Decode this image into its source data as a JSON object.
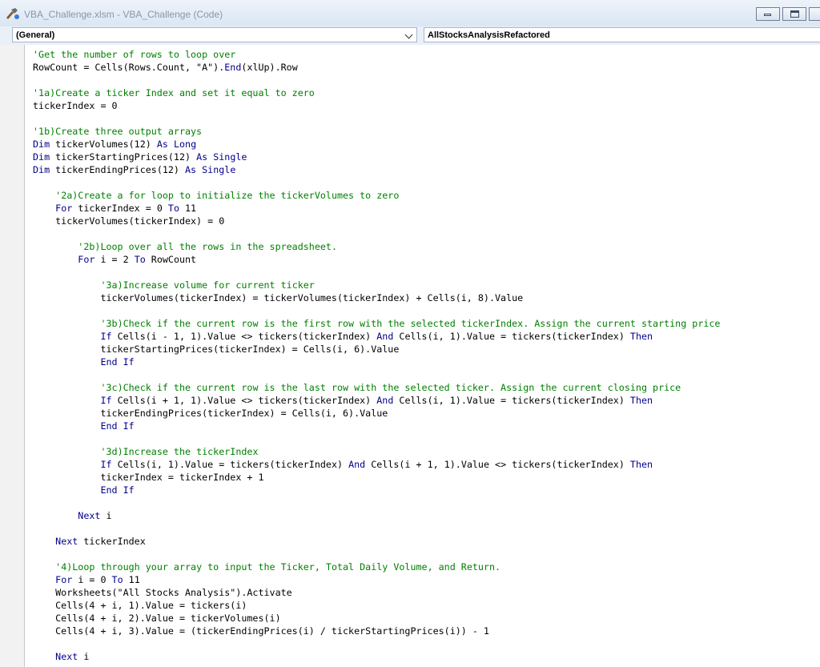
{
  "window": {
    "title": "VBA_Challenge.xlsm - VBA_Challenge (Code)",
    "buttons": [
      "minimize",
      "maximize",
      "close"
    ]
  },
  "selectors": {
    "object": "(General)",
    "procedure": "AllStocksAnalysisRefactored"
  },
  "colors": {
    "comment": "#008000",
    "keyword": "#00008b",
    "text": "#000000"
  },
  "code_lines": [
    {
      "indent": 0,
      "text": "'Get the number of rows to loop over",
      "type": "comment"
    },
    {
      "indent": 0,
      "text": "RowCount = Cells(Rows.Count, \"A\").End(xlUp).Row",
      "type": "code"
    },
    {
      "indent": 0,
      "text": "",
      "type": "blank"
    },
    {
      "indent": 0,
      "text": "'1a)Create a ticker Index and set it equal to zero",
      "type": "comment"
    },
    {
      "indent": 0,
      "text": "tickerIndex = 0",
      "type": "code"
    },
    {
      "indent": 0,
      "text": "",
      "type": "blank"
    },
    {
      "indent": 0,
      "text": "'1b)Create three output arrays",
      "type": "comment"
    },
    {
      "indent": 0,
      "text": "Dim tickerVolumes(12) As Long",
      "type": "code"
    },
    {
      "indent": 0,
      "text": "Dim tickerStartingPrices(12) As Single",
      "type": "code"
    },
    {
      "indent": 0,
      "text": "Dim tickerEndingPrices(12) As Single",
      "type": "code"
    },
    {
      "indent": 0,
      "text": "",
      "type": "blank"
    },
    {
      "indent": 1,
      "text": "'2a)Create a for loop to initialize the tickerVolumes to zero",
      "type": "comment"
    },
    {
      "indent": 1,
      "text": "For tickerIndex = 0 To 11",
      "type": "code"
    },
    {
      "indent": 1,
      "text": "tickerVolumes(tickerIndex) = 0",
      "type": "code"
    },
    {
      "indent": 0,
      "text": "",
      "type": "blank"
    },
    {
      "indent": 2,
      "text": "'2b)Loop over all the rows in the spreadsheet.",
      "type": "comment"
    },
    {
      "indent": 2,
      "text": "For i = 2 To RowCount",
      "type": "code"
    },
    {
      "indent": 0,
      "text": "",
      "type": "blank"
    },
    {
      "indent": 3,
      "text": "'3a)Increase volume for current ticker",
      "type": "comment"
    },
    {
      "indent": 3,
      "text": "tickerVolumes(tickerIndex) = tickerVolumes(tickerIndex) + Cells(i, 8).Value",
      "type": "code"
    },
    {
      "indent": 0,
      "text": "",
      "type": "blank"
    },
    {
      "indent": 3,
      "text": "'3b)Check if the current row is the first row with the selected tickerIndex. Assign the current starting price",
      "type": "comment"
    },
    {
      "indent": 3,
      "text": "If Cells(i - 1, 1).Value <> tickers(tickerIndex) And Cells(i, 1).Value = tickers(tickerIndex) Then",
      "type": "code"
    },
    {
      "indent": 3,
      "text": "tickerStartingPrices(tickerIndex) = Cells(i, 6).Value",
      "type": "code"
    },
    {
      "indent": 3,
      "text": "End If",
      "type": "code"
    },
    {
      "indent": 0,
      "text": "",
      "type": "blank"
    },
    {
      "indent": 3,
      "text": "'3c)Check if the current row is the last row with the selected ticker. Assign the current closing price",
      "type": "comment"
    },
    {
      "indent": 3,
      "text": "If Cells(i + 1, 1).Value <> tickers(tickerIndex) And Cells(i, 1).Value = tickers(tickerIndex) Then",
      "type": "code"
    },
    {
      "indent": 3,
      "text": "tickerEndingPrices(tickerIndex) = Cells(i, 6).Value",
      "type": "code"
    },
    {
      "indent": 3,
      "text": "End If",
      "type": "code"
    },
    {
      "indent": 0,
      "text": "",
      "type": "blank"
    },
    {
      "indent": 3,
      "text": "'3d)Increase the tickerIndex",
      "type": "comment"
    },
    {
      "indent": 3,
      "text": "If Cells(i, 1).Value = tickers(tickerIndex) And Cells(i + 1, 1).Value <> tickers(tickerIndex) Then",
      "type": "code"
    },
    {
      "indent": 3,
      "text": "tickerIndex = tickerIndex + 1",
      "type": "code"
    },
    {
      "indent": 3,
      "text": "End If",
      "type": "code"
    },
    {
      "indent": 0,
      "text": "",
      "type": "blank"
    },
    {
      "indent": 2,
      "text": "Next i",
      "type": "code"
    },
    {
      "indent": 0,
      "text": "",
      "type": "blank"
    },
    {
      "indent": 1,
      "text": "Next tickerIndex",
      "type": "code"
    },
    {
      "indent": 0,
      "text": "",
      "type": "blank"
    },
    {
      "indent": 1,
      "text": "'4)Loop through your array to input the Ticker, Total Daily Volume, and Return.",
      "type": "comment"
    },
    {
      "indent": 1,
      "text": "For i = 0 To 11",
      "type": "code"
    },
    {
      "indent": 1,
      "text": "Worksheets(\"All Stocks Analysis\").Activate",
      "type": "code"
    },
    {
      "indent": 1,
      "text": "Cells(4 + i, 1).Value = tickers(i)",
      "type": "code"
    },
    {
      "indent": 1,
      "text": "Cells(4 + i, 2).Value = tickerVolumes(i)",
      "type": "code"
    },
    {
      "indent": 1,
      "text": "Cells(4 + i, 3).Value = (tickerEndingPrices(i) / tickerStartingPrices(i)) - 1",
      "type": "code"
    },
    {
      "indent": 0,
      "text": "",
      "type": "blank"
    },
    {
      "indent": 1,
      "text": "Next i",
      "type": "code"
    }
  ]
}
